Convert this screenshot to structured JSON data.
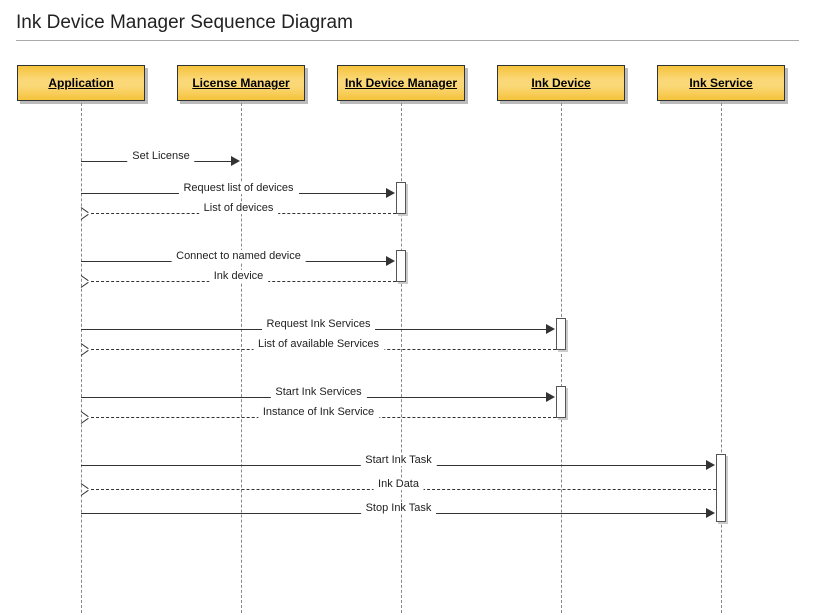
{
  "title": "Ink Device Manager Sequence Diagram",
  "participants": {
    "application": "Application",
    "license_manager": "License Manager",
    "ink_device_manager": "Ink Device Manager",
    "ink_device": "Ink Device",
    "ink_service": "Ink Service"
  },
  "messages": {
    "set_license": "Set License",
    "request_list_of_devices": "Request list of devices",
    "list_of_devices": "List of devices",
    "connect_to_named_device": "Connect to named device",
    "ink_device": "Ink device",
    "request_ink_services": "Request Ink Services",
    "list_of_available_services": "List of available Services",
    "start_ink_services": "Start Ink Services",
    "instance_of_ink_service": "Instance of Ink Service",
    "start_ink_task": "Start Ink Task",
    "ink_data": "Ink Data",
    "stop_ink_task": "Stop Ink Task"
  },
  "chart_data": {
    "type": "sequence-diagram",
    "title": "Ink Device Manager Sequence Diagram",
    "participants": [
      "Application",
      "License Manager",
      "Ink Device Manager",
      "Ink Device",
      "Ink Service"
    ],
    "interactions": [
      {
        "from": "Application",
        "to": "License Manager",
        "label": "Set License",
        "kind": "call"
      },
      {
        "from": "Application",
        "to": "Ink Device Manager",
        "label": "Request list of devices",
        "kind": "call"
      },
      {
        "from": "Ink Device Manager",
        "to": "Application",
        "label": "List of devices",
        "kind": "return"
      },
      {
        "from": "Application",
        "to": "Ink Device Manager",
        "label": "Connect to named device",
        "kind": "call"
      },
      {
        "from": "Ink Device Manager",
        "to": "Application",
        "label": "Ink device",
        "kind": "return"
      },
      {
        "from": "Application",
        "to": "Ink Device",
        "label": "Request Ink Services",
        "kind": "call"
      },
      {
        "from": "Ink Device",
        "to": "Application",
        "label": "List of available Services",
        "kind": "return"
      },
      {
        "from": "Application",
        "to": "Ink Device",
        "label": "Start Ink Services",
        "kind": "call"
      },
      {
        "from": "Ink Device",
        "to": "Application",
        "label": "Instance of Ink Service",
        "kind": "return"
      },
      {
        "from": "Application",
        "to": "Ink Service",
        "label": "Start Ink Task",
        "kind": "call"
      },
      {
        "from": "Ink Service",
        "to": "Application",
        "label": "Ink Data",
        "kind": "return"
      },
      {
        "from": "Application",
        "to": "Ink Service",
        "label": "Stop Ink Task",
        "kind": "call"
      }
    ]
  }
}
